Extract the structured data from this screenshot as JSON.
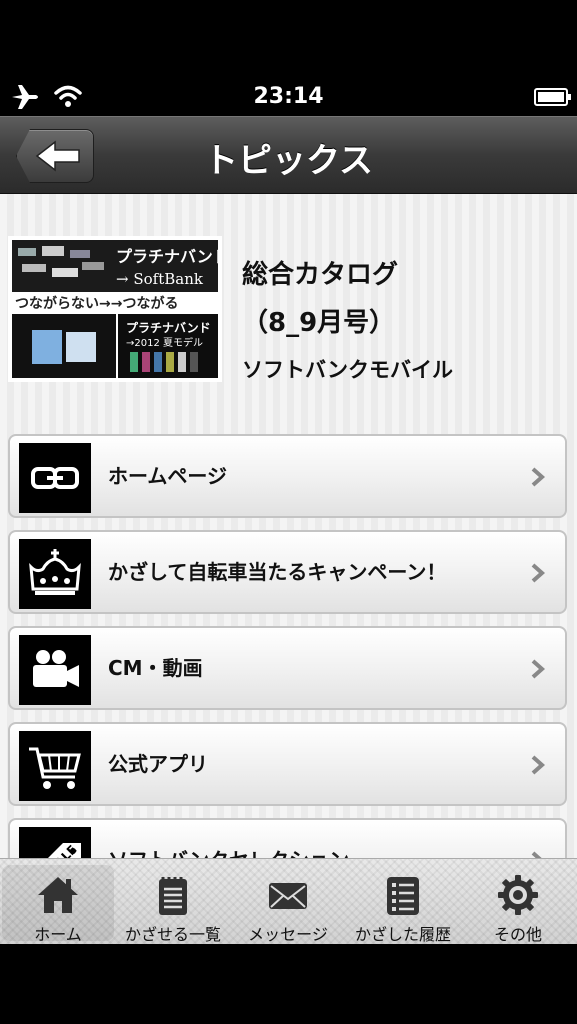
{
  "status_bar": {
    "time": "23:14",
    "icons": [
      "airplane-icon",
      "wifi-icon",
      "battery-icon"
    ]
  },
  "nav": {
    "title": "トピックス",
    "back_icon": "arrow-left-icon"
  },
  "catalog": {
    "title": "総合カタログ",
    "issue": "（8_9月号）",
    "publisher": "ソフトバンクモバイル",
    "thumbnail_text": {
      "brand_line1": "プラチナバンド",
      "brand_line2": "→ SoftBank",
      "tagline": "つながらない→→つながる",
      "sub": "プラチナバンド",
      "sub2": "→2012 夏モデル"
    }
  },
  "menu": [
    {
      "label": "ホームページ",
      "icon": "link-icon"
    },
    {
      "label": "かざして自転車当たるキャンペーン！",
      "icon": "crown-icon"
    },
    {
      "label": "CM・動画",
      "icon": "video-camera-icon"
    },
    {
      "label": "公式アプリ",
      "icon": "shopping-cart-icon"
    },
    {
      "label": "ソフトバンクセレクション",
      "icon": "tag-icon"
    }
  ],
  "tabs": [
    {
      "label": "ホーム",
      "icon": "home-icon",
      "active": true
    },
    {
      "label": "かざせる一覧",
      "icon": "notepad-icon",
      "active": false
    },
    {
      "label": "メッセージ",
      "icon": "envelope-icon",
      "active": false
    },
    {
      "label": "かざした履歴",
      "icon": "list-icon",
      "active": false
    },
    {
      "label": "その他",
      "icon": "gear-icon",
      "active": false
    }
  ],
  "colors": {
    "nav_bar": "#3a3a3a",
    "icon_tile": "#000000",
    "tab_bar": "#dcdcdc"
  }
}
